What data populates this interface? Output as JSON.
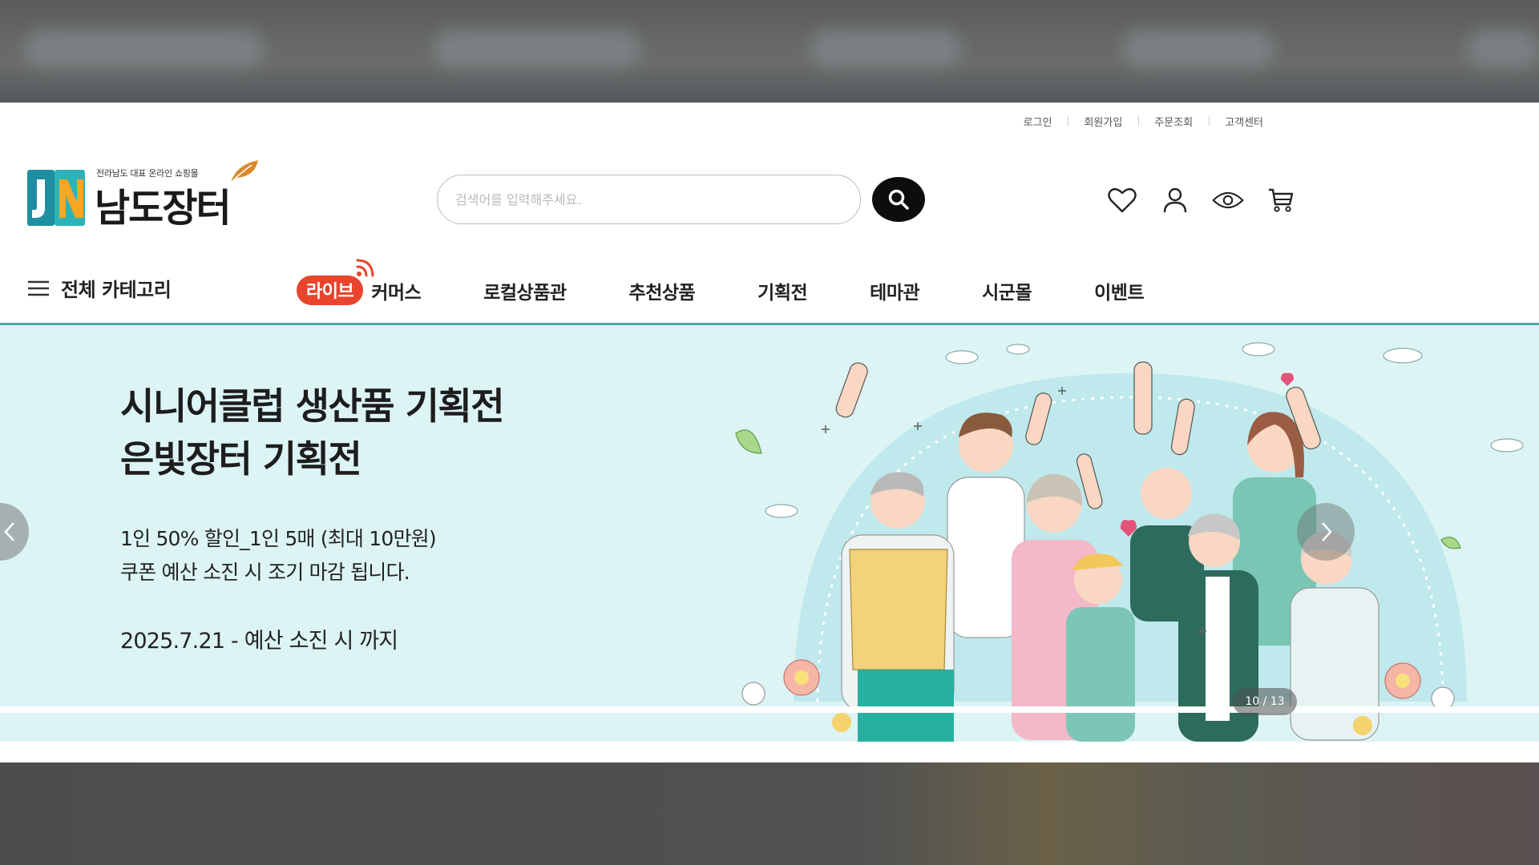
{
  "utility_links": [
    "로그인",
    "회원가입",
    "주문조회",
    "고객센터"
  ],
  "logo": {
    "tagline": "전라남도 대표 온라인 쇼핑몰",
    "name": "남도장터",
    "mark": "JN"
  },
  "search": {
    "placeholder": "검색어를 입력해주세요."
  },
  "header_icons": [
    "heart-icon",
    "user-icon",
    "eye-icon",
    "cart-icon"
  ],
  "nav": {
    "all_categories": "전체 카테고리",
    "live_badge": "라이브",
    "live_label": "커머스",
    "items": [
      "로컬상품관",
      "추천상품",
      "기획전",
      "테마관",
      "시군몰",
      "이벤트"
    ]
  },
  "banner": {
    "title_line1": "시니어클럽 생산품 기획전",
    "title_line2": "은빛장터 기획전",
    "desc_line1": "1인 50% 할인_1인 5매 (최대 10만원)",
    "desc_line2": "쿠폰 예산 소진 시 조기 마감 됩니다.",
    "date": "2025.7.21 - 예산 소진 시 까지",
    "slide_counter": "10 / 13",
    "background": "#ddf4f5"
  },
  "colors": {
    "accent": "#4aa6a8",
    "live_red": "#e9442d",
    "logo_teal": "#1e8fa0",
    "logo_orange": "#f5a623"
  }
}
